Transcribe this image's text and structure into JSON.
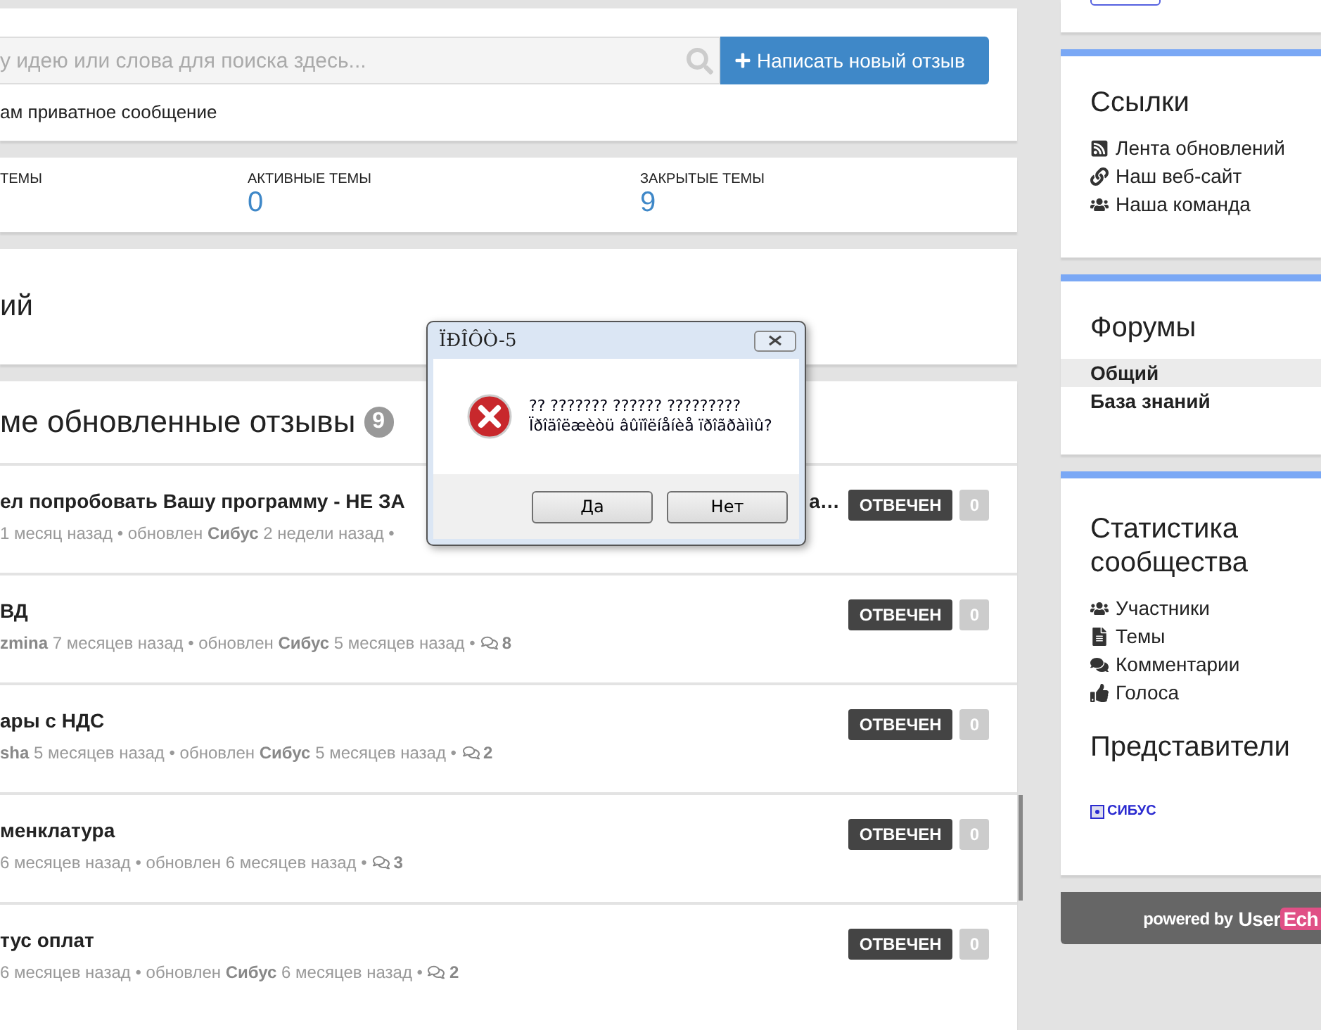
{
  "search": {
    "placeholder": "у идею или слова для поиска здесь...",
    "button": "Написать новый отзыв"
  },
  "private_message": "ам приватное сообщение",
  "stats": [
    {
      "label": "ТЕМЫ"
    },
    {
      "label": "АКТИВНЫЕ ТЕМЫ",
      "value": "0"
    },
    {
      "label": "ЗАКРЫТЫЕ ТЕМЫ",
      "value": "9"
    }
  ],
  "forum_heading": "ий",
  "topics_header": {
    "title": "ме обновленные отзывы",
    "count": "9"
  },
  "topics": [
    {
      "title": "ел попробовать Вашу программу - НЕ ЗА",
      "title_tail": "а…",
      "meta": "1 месяц назад • обновлен **Сибус** 2 недели назад •",
      "status": "ОТВЕЧЕН",
      "votes": "0"
    },
    {
      "title": "ВД",
      "meta": "**zmina** 7 месяцев назад • обновлен **Сибус** 5 месяцев назад •",
      "comments": "8",
      "status": "ОТВЕЧЕН",
      "votes": "0"
    },
    {
      "title": "ары с НДС",
      "meta": "**sha** 5 месяцев назад • обновлен **Сибус** 5 месяцев назад •",
      "comments": "2",
      "status": "ОТВЕЧЕН",
      "votes": "0"
    },
    {
      "title": "менклатура",
      "meta": "6 месяцев назад • обновлен 6 месяцев назад •",
      "comments": "3",
      "status": "ОТВЕЧЕН",
      "votes": "0"
    },
    {
      "title": "тус оплат",
      "meta": "6 месяцев назад • обновлен **Сибус** 6 месяцев назад •",
      "comments": "2",
      "status": "ОТВЕЧЕН",
      "votes": "0"
    }
  ],
  "links": {
    "title": "Ссылки",
    "items": [
      {
        "label": "Лента обновлений"
      },
      {
        "label": "Наш веб-сайт"
      },
      {
        "label": "Наша команда"
      }
    ]
  },
  "forums": {
    "title": "Форумы",
    "items": [
      {
        "label": "Общий",
        "selected": true
      },
      {
        "label": "База знаний",
        "selected": false
      }
    ]
  },
  "community": {
    "title": "Статистика сообщества",
    "items": [
      {
        "label": "Участники"
      },
      {
        "label": "Темы"
      },
      {
        "label": "Комментарии"
      },
      {
        "label": "Голоса"
      }
    ]
  },
  "representatives": {
    "title": "Представители",
    "items": [
      "СИБУС"
    ]
  },
  "footer": {
    "text": "powered by",
    "logo_a": "User",
    "logo_b": "Ech"
  },
  "dialog": {
    "title": "ÏÐÎÔÒ-5",
    "line_1": "?? ??????? ?????? ?????????",
    "line_2": "Ïðîäîëæèòü âûïîëíåíèå ïðîãðàììû?",
    "buttons": [
      "Да",
      "Нет"
    ]
  }
}
